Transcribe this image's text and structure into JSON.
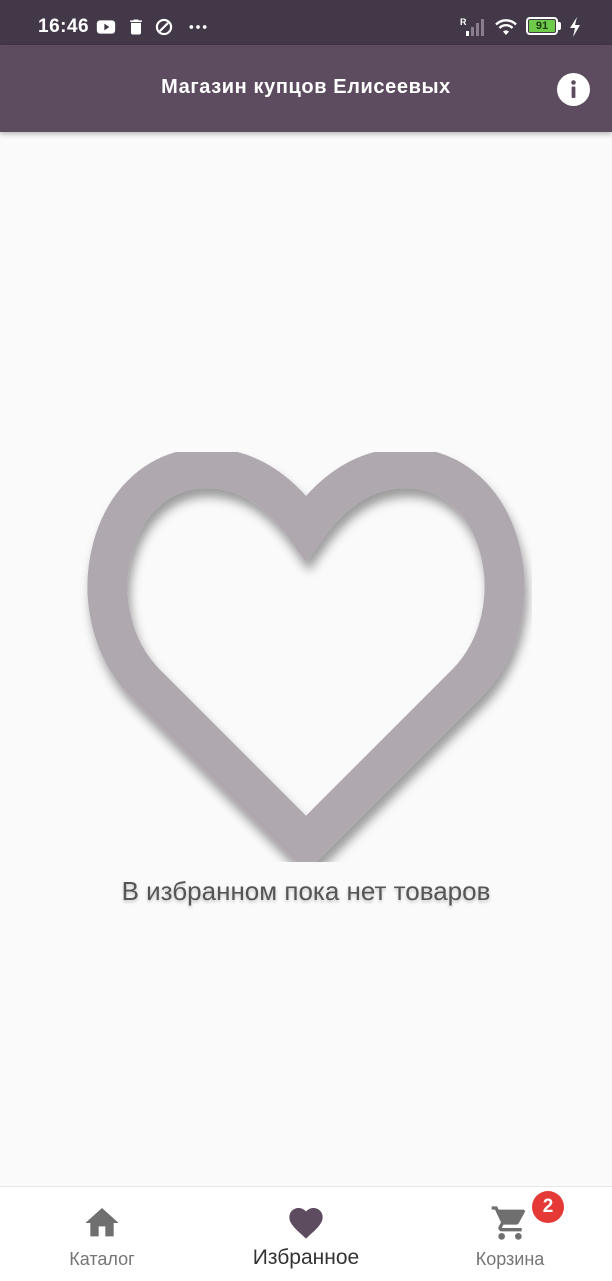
{
  "status_bar": {
    "time": "16:46",
    "battery_level": "91",
    "icons": [
      "youtube-icon",
      "trash-icon",
      "vpn-icon",
      "more-dots-icon",
      "signal-icon",
      "wifi-icon",
      "battery-icon",
      "charging-icon"
    ]
  },
  "header": {
    "title": "Магазин купцов Елисеевых",
    "info_icon": "info-icon",
    "background": "#5d4b5f"
  },
  "main": {
    "empty_icon": "heart-outline-icon",
    "empty_message": "В избранном пока нет товаров",
    "heart_color": "#b0a8af"
  },
  "bottom_nav": {
    "items": [
      {
        "label": "Каталог",
        "icon": "home-icon",
        "active": false
      },
      {
        "label": "Избранное",
        "icon": "heart-icon",
        "active": true
      },
      {
        "label": "Корзина",
        "icon": "cart-icon",
        "active": false,
        "badge": "2"
      }
    ],
    "active_color": "#5d4b5f",
    "inactive_color": "#6f6f6f",
    "badge_color": "#e53935"
  }
}
